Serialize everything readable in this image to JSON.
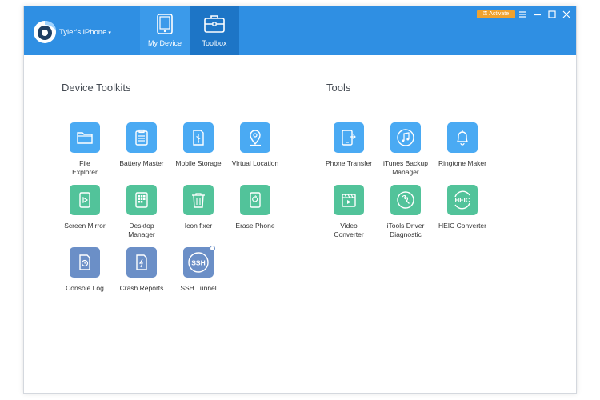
{
  "header": {
    "device_name": "Tyler's iPhone",
    "caret": "▾",
    "tabs": [
      {
        "label": "My Device"
      },
      {
        "label": "Toolbox"
      }
    ],
    "activate_label": "Activate",
    "active_tab": "Toolbox"
  },
  "sections": {
    "device_toolkits_title": "Device Toolkits",
    "tools_title": "Tools"
  },
  "device_toolkits": [
    {
      "label": "File\nExplorer",
      "icon": "folder-icon",
      "color": "blue"
    },
    {
      "label": "Battery Master",
      "icon": "clipboard-icon",
      "color": "blue"
    },
    {
      "label": "Mobile Storage",
      "icon": "usb-icon",
      "color": "blue"
    },
    {
      "label": "Virtual Location",
      "icon": "location-pin-icon",
      "color": "blue"
    },
    {
      "label": "Screen Mirror",
      "icon": "play-screen-icon",
      "color": "green"
    },
    {
      "label": "Desktop\nManager",
      "icon": "grid-icon",
      "color": "green"
    },
    {
      "label": "Icon fixer",
      "icon": "trash-icon",
      "color": "green"
    },
    {
      "label": "Erase Phone",
      "icon": "erase-phone-icon",
      "color": "green"
    },
    {
      "label": "Console Log",
      "icon": "clock-document-icon",
      "color": "slate"
    },
    {
      "label": "Crash Reports",
      "icon": "lightning-document-icon",
      "color": "slate"
    },
    {
      "label": "SSH Tunnel",
      "icon": "ssh-icon",
      "color": "slate",
      "badge_text": "SSH"
    }
  ],
  "tools": [
    {
      "label": "Phone Transfer",
      "icon": "phone-transfer-icon",
      "color": "blue"
    },
    {
      "label": "iTunes Backup\nManager",
      "icon": "music-icon",
      "color": "blue"
    },
    {
      "label": "Ringtone Maker",
      "icon": "bell-icon",
      "color": "blue"
    },
    {
      "label": "Video\nConverter",
      "icon": "video-icon",
      "color": "green"
    },
    {
      "label": "iTools Driver\nDiagnostic",
      "icon": "wrench-icon",
      "color": "green"
    },
    {
      "label": "HEIC Converter",
      "icon": "heic-icon",
      "color": "green",
      "badge_text": "HEIC"
    }
  ],
  "colors": {
    "titlebar": "#2f8fe3",
    "tab_active": "#1d75c6",
    "activate": "#f0a22e",
    "icon_blue": "#4aaaf3",
    "icon_green": "#52c39a",
    "icon_slate": "#6b8fc7"
  }
}
